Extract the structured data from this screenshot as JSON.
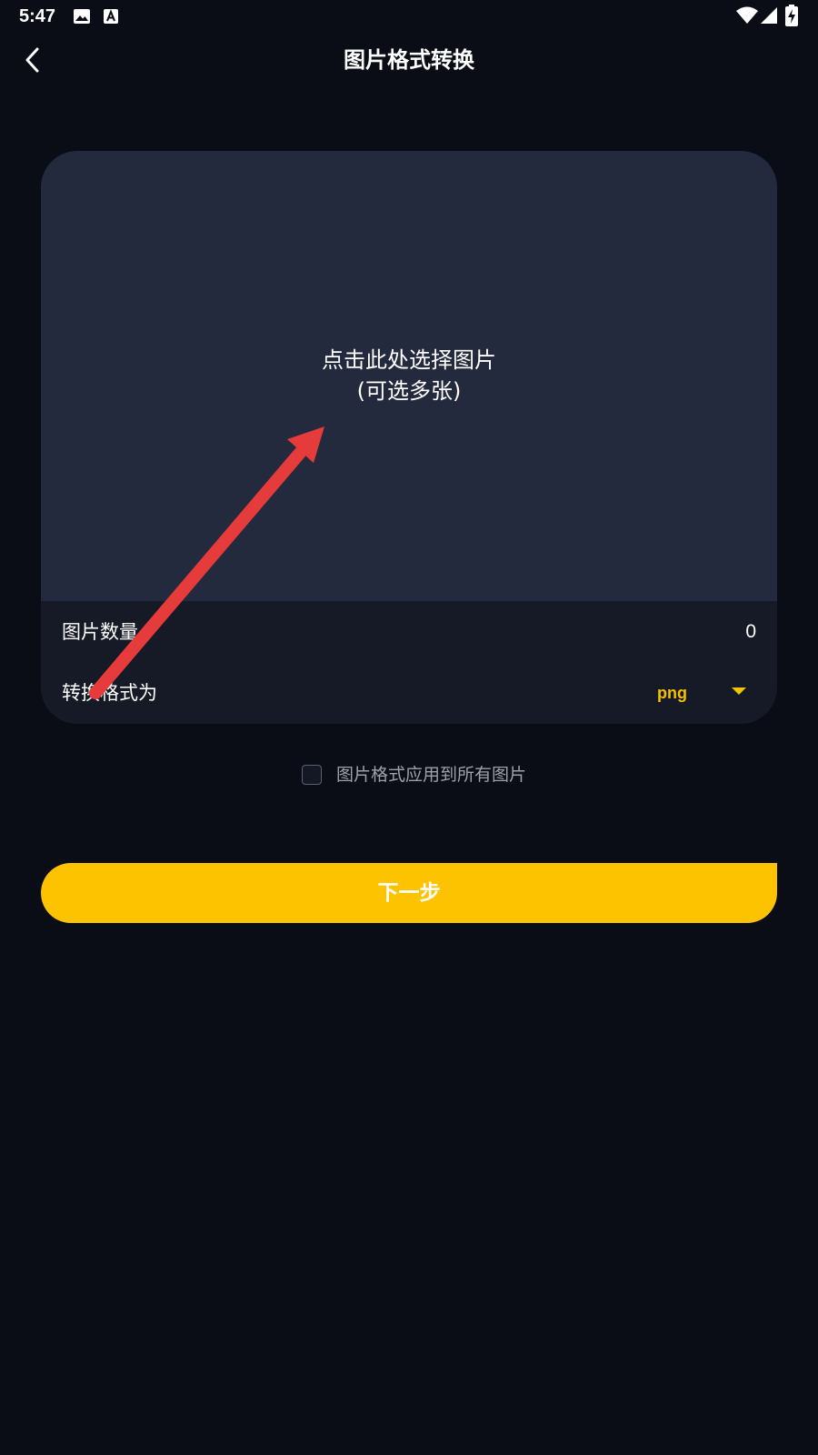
{
  "status_bar": {
    "time": "5:47",
    "icons": [
      "image-icon",
      "text-a-icon",
      "wifi-icon",
      "signal-icon",
      "battery-charging-icon"
    ]
  },
  "app_bar": {
    "back_icon": "chevron-left-icon",
    "title": "图片格式转换"
  },
  "picker": {
    "line1": "点击此处选择图片",
    "line2": "(可选多张)"
  },
  "details": {
    "count_label": "图片数量",
    "count_value": "0",
    "format_label": "转换格式为",
    "format_value": "png",
    "format_icon": "caret-down-icon"
  },
  "apply_all": {
    "label": "图片格式应用到所有图片",
    "checked": false
  },
  "next_button": {
    "label": "下一步"
  },
  "colors": {
    "background": "#0a0d16",
    "card": "#161a26",
    "picker_area": "#242a3e",
    "accent": "#fdc300",
    "format_value": "#f5c200",
    "annotation_arrow": "#e53b3b"
  }
}
